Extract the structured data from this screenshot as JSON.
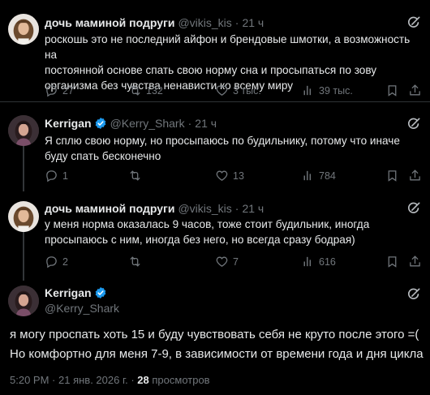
{
  "tweets": [
    {
      "name": "дочь маминой подруги",
      "handle": "@vikis_kis",
      "time": "21 ч",
      "verified": false,
      "text": "роскошь это не последний айфон и брендовые шмотки, а возможность на\nпостоянной основе спать свою норму сна и просыпаться по зову\nорганизма без чувства ненависти ко всему миру",
      "replies": "27",
      "retweets": "132",
      "likes": "3 тыс.",
      "views": "39 тыс."
    },
    {
      "name": "Kerrigan",
      "handle": "@Kerry_Shark",
      "time": "21 ч",
      "verified": true,
      "text": "Я сплю свою норму, но просыпаюсь по будильнику, потому что иначе\nбуду спать бесконечно",
      "replies": "1",
      "retweets": "",
      "likes": "13",
      "views": "784"
    },
    {
      "name": "дочь маминой подруги",
      "handle": "@vikis_kis",
      "time": "21 ч",
      "verified": false,
      "text": "у меня норма оказалась 9 часов, тоже стоит будильник, иногда\nпросыпаюсь с ним, иногда без него, но всегда сразу бодрая)",
      "replies": "2",
      "retweets": "",
      "likes": "7",
      "views": "616"
    }
  ],
  "main": {
    "name": "Kerrigan",
    "handle": "@Kerry_Shark",
    "text": "я могу проспать хоть 15 и буду чувствовать себя не круто после этого =(\nНо комфортно для меня 7-9, в зависимости от времени года и дня цикла",
    "time": "5:20 PM",
    "date": "21 янв. 2026 г.",
    "views_count": "28",
    "views_label": "просмотров"
  },
  "colors": {
    "background": "#000000",
    "text": "#e7e9ea",
    "muted": "#71767b",
    "verified": "#1d9bf0",
    "separator": "#2f3336"
  },
  "icons": [
    "grok-icon",
    "reply-icon",
    "retweet-icon",
    "like-icon",
    "views-icon",
    "bookmark-icon",
    "share-icon",
    "verified-icon"
  ]
}
